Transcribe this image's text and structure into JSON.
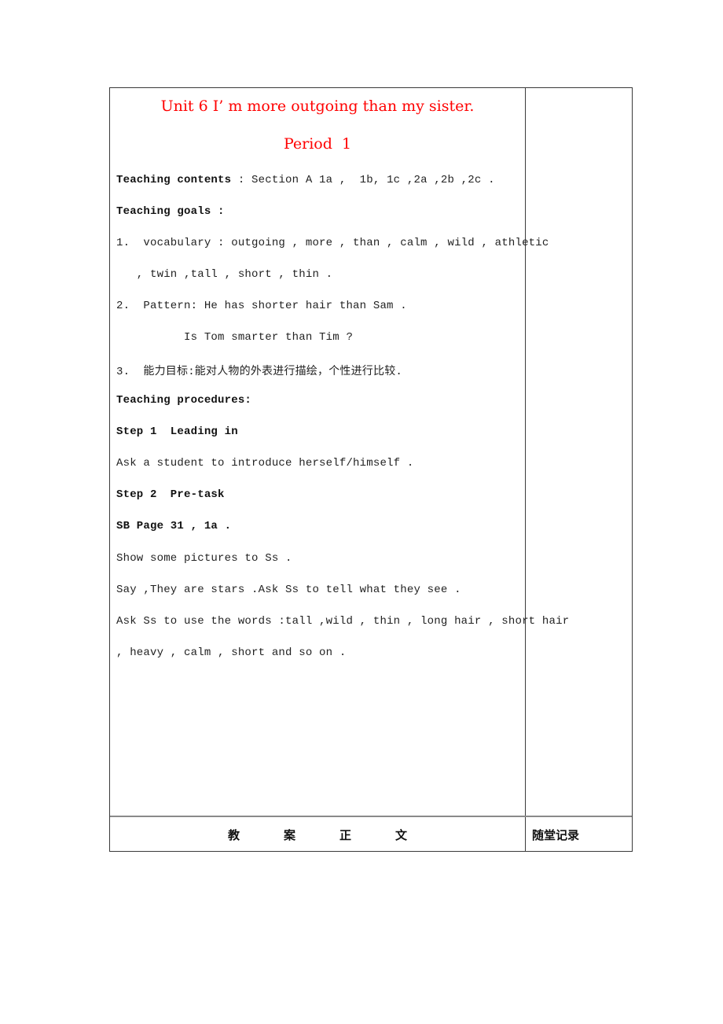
{
  "document": {
    "title": "Unit 6 I’ m more outgoing than my sister.",
    "subtitle": "Period  1",
    "teaching_contents": {
      "label": "Teaching contents",
      "value": " : Section A 1a ,  1b, 1c ,2a ,2b ,2c ."
    },
    "teaching_goals_label": "Teaching goals :",
    "goal_1_line1": "1.  vocabulary : outgoing , more , than , calm , wild , athletic",
    "goal_1_line2": "   , twin ,tall , short , thin .",
    "goal_2_line1": "2.  Pattern: He has shorter hair than Sam .",
    "goal_2_line2": "          Is Tom smarter than Tim ?",
    "goal_3": "3.  能力目标:能对人物的外表进行描绘，个性进行比较.",
    "procedures_label": "Teaching procedures:",
    "step1_heading": "Step 1  Leading in",
    "step1_text": "Ask a student to introduce herself/himself .",
    "step2_heading": "Step 2  Pre-task",
    "step2_ref": "SB Page 31 , 1a .",
    "step2_line1": "Show some pictures to Ss .",
    "step2_line2": "Say ,They are stars .Ask Ss to tell what they see .",
    "step2_line3": "Ask Ss to use the words :tall ,wild , thin , long hair , short hair",
    "step2_line4": ", heavy , calm , short and so on ."
  },
  "footer": {
    "left_chars": [
      "教",
      "案",
      "正",
      "文"
    ],
    "right_label": "随堂记录"
  },
  "colors": {
    "title": "#ff0000",
    "border": "#3a3a3a"
  }
}
